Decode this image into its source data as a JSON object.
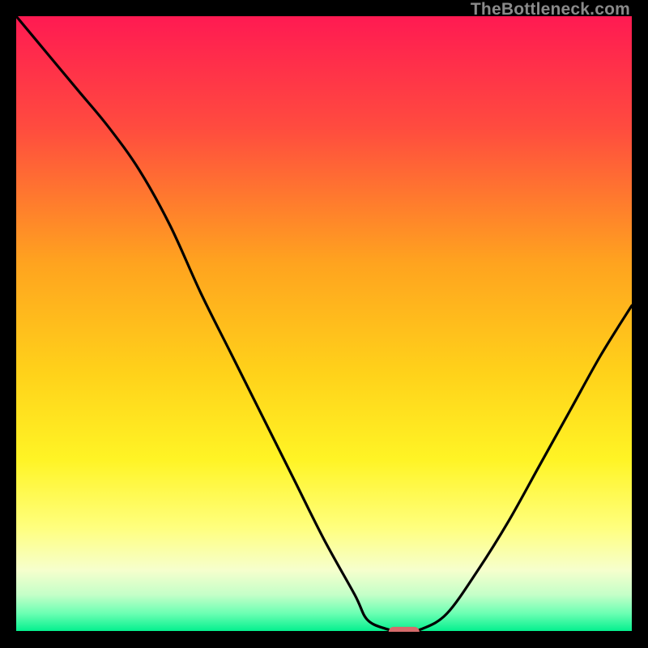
{
  "watermark": "TheBottleneck.com",
  "chart_data": {
    "type": "line",
    "title": "",
    "xlabel": "",
    "ylabel": "",
    "xlim": [
      0,
      100
    ],
    "ylim": [
      0,
      100
    ],
    "grid": false,
    "background_gradient": [
      {
        "stop": 0.0,
        "color": "#ff1a52"
      },
      {
        "stop": 0.18,
        "color": "#ff4b3f"
      },
      {
        "stop": 0.4,
        "color": "#ffa31f"
      },
      {
        "stop": 0.58,
        "color": "#ffd21a"
      },
      {
        "stop": 0.72,
        "color": "#fff425"
      },
      {
        "stop": 0.83,
        "color": "#ffff7d"
      },
      {
        "stop": 0.9,
        "color": "#f6ffcd"
      },
      {
        "stop": 0.94,
        "color": "#c4ffc8"
      },
      {
        "stop": 0.97,
        "color": "#6cffb3"
      },
      {
        "stop": 1.0,
        "color": "#00ef8d"
      }
    ],
    "series": [
      {
        "name": "bottleneck-curve",
        "color": "#000000",
        "x": [
          0,
          5,
          10,
          15,
          20,
          25,
          30,
          35,
          40,
          45,
          50,
          55,
          57,
          60,
          63,
          66,
          70,
          75,
          80,
          85,
          90,
          95,
          100
        ],
        "y": [
          100,
          94,
          88,
          82,
          75,
          66,
          55,
          45,
          35,
          25,
          15,
          6,
          2,
          0.5,
          0,
          0.5,
          3,
          10,
          18,
          27,
          36,
          45,
          53
        ]
      }
    ],
    "marker": {
      "name": "optimal-range",
      "shape": "capsule",
      "color": "#d66b6b",
      "cx": 63,
      "cy": 0,
      "width_pct": 5,
      "height_pct": 1.6
    },
    "baseline": {
      "name": "x-axis-line",
      "y": 0,
      "color": "#000000"
    }
  }
}
